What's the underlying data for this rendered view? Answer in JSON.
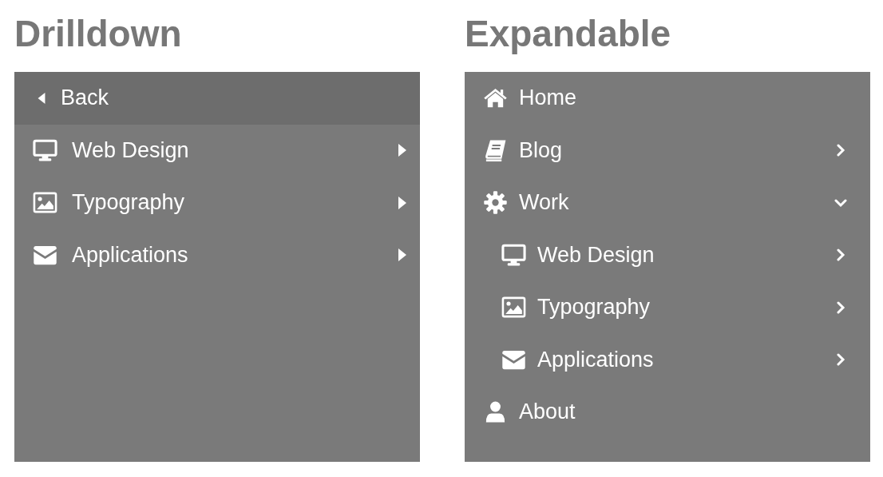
{
  "drilldown": {
    "title": "Drilldown",
    "back": {
      "label": "Back"
    },
    "items": [
      {
        "label": "Web Design",
        "kind": "submenu"
      },
      {
        "label": "Typography",
        "kind": "submenu"
      },
      {
        "label": "Applications",
        "kind": "submenu"
      }
    ]
  },
  "expandable": {
    "title": "Expandable",
    "items": [
      {
        "label": "Home",
        "kind": "link"
      },
      {
        "label": "Blog",
        "kind": "submenu",
        "expanded": false
      },
      {
        "label": "Work",
        "kind": "submenu",
        "expanded": true,
        "children": [
          {
            "label": "Web Design",
            "kind": "submenu",
            "expanded": false
          },
          {
            "label": "Typography",
            "kind": "submenu",
            "expanded": false
          },
          {
            "label": "Applications",
            "kind": "submenu",
            "expanded": false
          }
        ]
      },
      {
        "label": "About",
        "kind": "link"
      }
    ]
  }
}
